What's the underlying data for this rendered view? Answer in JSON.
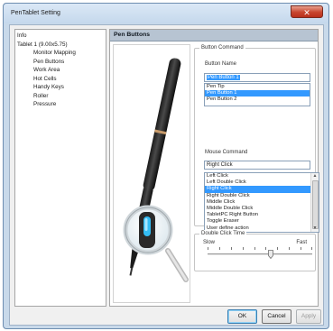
{
  "window": {
    "title": "PenTablet Setting",
    "close_glyph": "✕"
  },
  "tree": {
    "items": [
      {
        "label": "Info",
        "level": 0
      },
      {
        "label": "Tablet 1 (9.00x5.75)",
        "level": 0
      },
      {
        "label": "Monitor Mapping",
        "level": 1
      },
      {
        "label": "Pen Buttons",
        "level": 1
      },
      {
        "label": "Work Area",
        "level": 1
      },
      {
        "label": "Hot Cells",
        "level": 1
      },
      {
        "label": "Handy Keys",
        "level": 1
      },
      {
        "label": "Roller",
        "level": 1
      },
      {
        "label": "Pressure",
        "level": 1
      }
    ]
  },
  "panel": {
    "title": "Pen Buttons",
    "button_command": {
      "group_label": "Button Command",
      "button_name_label": "Button Name",
      "button_name_value": "Pen Button 1",
      "button_list": [
        "Pen Tip",
        "Pen Button 1",
        "Pen Button 2"
      ],
      "button_list_selected": "Pen Button 1",
      "mouse_command_label": "Mouse Command",
      "mouse_command_value": "Right Click",
      "mouse_list": [
        "Left Click",
        "Left Double Click",
        "Right Click",
        "Right Double Click",
        "Middle Click",
        "Middle Double Click",
        "TabletPC Right Button",
        "Toggle Eraser",
        "User define action"
      ],
      "mouse_list_selected": "Right Click"
    },
    "double_click": {
      "group_label": "Double Click Time",
      "slow_label": "Slow",
      "fast_label": "Fast",
      "value_fraction": 0.6
    }
  },
  "footer": {
    "ok_label": "OK",
    "cancel_label": "Cancel",
    "apply_label": "Apply"
  },
  "colors": {
    "selection": "#3399ff",
    "accent_blue_window": "#dbe8f6"
  },
  "icons": {
    "close": "close-icon",
    "scroll_up": "scroll-up-arrow-icon",
    "scroll_down": "scroll-down-arrow-icon"
  }
}
